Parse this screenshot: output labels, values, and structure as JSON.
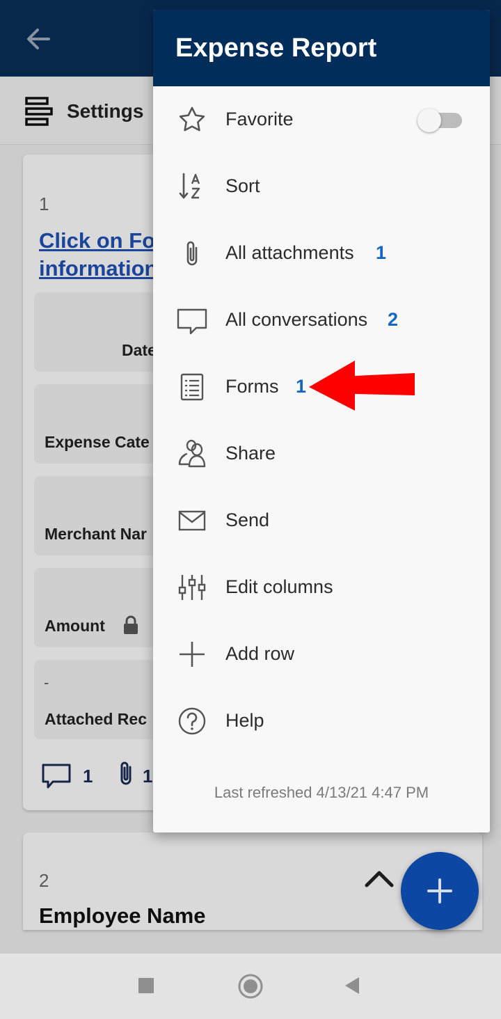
{
  "app": {
    "settings_label": "Settings",
    "card1": {
      "row_number": "1",
      "link_line1": "Click on Fo",
      "link_line2": "information",
      "fields": [
        "Date",
        "Expense Cate",
        "Merchant Nar",
        "Amount",
        "Attached Rec"
      ],
      "attached_dash": "-",
      "conversation_count": "1",
      "attachment_count": "1"
    },
    "card2": {
      "row_number": "2",
      "title": "Employee Name"
    }
  },
  "menu": {
    "title": "Expense Report",
    "items": [
      {
        "label": "Favorite",
        "icon": "star-icon",
        "toggle": false
      },
      {
        "label": "Sort",
        "icon": "sort-az-icon"
      },
      {
        "label": "All attachments",
        "icon": "paperclip-icon",
        "badge": "1"
      },
      {
        "label": "All conversations",
        "icon": "comment-icon",
        "badge": "2"
      },
      {
        "label": "Forms",
        "icon": "form-icon",
        "badge": "1"
      },
      {
        "label": "Share",
        "icon": "people-icon"
      },
      {
        "label": "Send",
        "icon": "envelope-icon"
      },
      {
        "label": "Edit columns",
        "icon": "sliders-icon"
      },
      {
        "label": "Add row",
        "icon": "plus-icon"
      },
      {
        "label": "Help",
        "icon": "help-circle-icon"
      }
    ],
    "last_refreshed": "Last refreshed 4/13/21 4:47 PM"
  },
  "colors": {
    "header_navy": "#002d5a",
    "badge_blue": "#1665c0",
    "fab_blue": "#0c47a3",
    "annotation_red": "#ff0000"
  }
}
